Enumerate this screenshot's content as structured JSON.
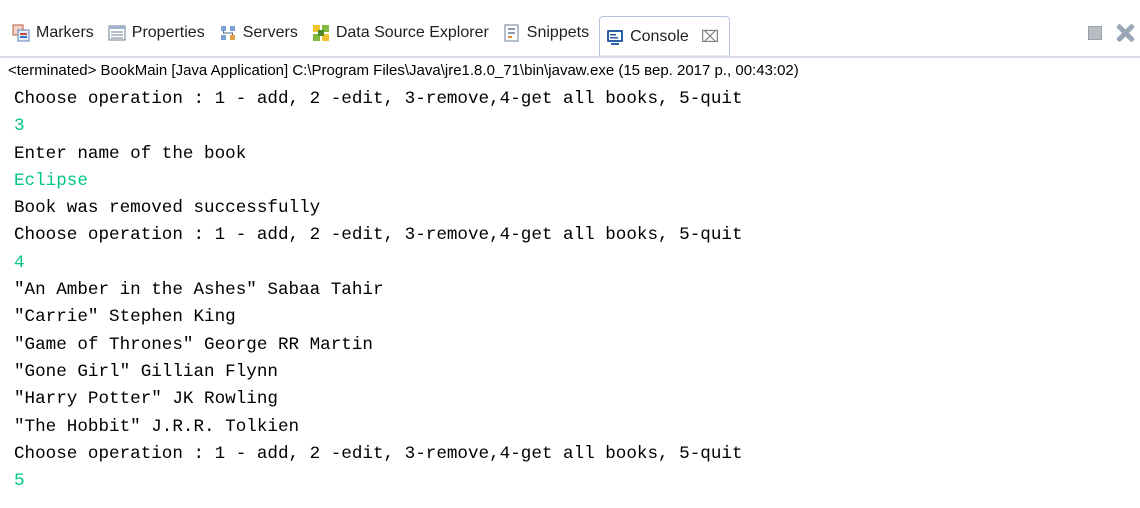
{
  "tabs": [
    {
      "label": "Markers",
      "icon": "markers-icon",
      "active": false
    },
    {
      "label": "Properties",
      "icon": "properties-icon",
      "active": false
    },
    {
      "label": "Servers",
      "icon": "servers-icon",
      "active": false
    },
    {
      "label": "Data Source Explorer",
      "icon": "data-source-icon",
      "active": false
    },
    {
      "label": "Snippets",
      "icon": "snippets-icon",
      "active": false
    },
    {
      "label": "Console",
      "icon": "console-icon",
      "active": true,
      "close": "⌧"
    }
  ],
  "status": "<terminated> BookMain [Java Application] C:\\Program Files\\Java\\jre1.8.0_71\\bin\\javaw.exe (15 вер. 2017 р., 00:43:02)",
  "colors": {
    "output": "#000000",
    "input": "#00c87f"
  },
  "console": [
    {
      "text": "Choose operation : 1 - add, 2 -edit, 3-remove,4-get all books, 5-quit",
      "kind": "out"
    },
    {
      "text": "3",
      "kind": "in"
    },
    {
      "text": "Enter name of the book",
      "kind": "out"
    },
    {
      "text": "Eclipse",
      "kind": "in"
    },
    {
      "text": "Book was removed successfully",
      "kind": "out"
    },
    {
      "text": "Choose operation : 1 - add, 2 -edit, 3-remove,4-get all books, 5-quit",
      "kind": "out"
    },
    {
      "text": "4",
      "kind": "in"
    },
    {
      "text": "\"An Amber in the Ashes\" Sabaa Tahir",
      "kind": "out"
    },
    {
      "text": "\"Carrie\" Stephen King",
      "kind": "out"
    },
    {
      "text": "\"Game of Thrones\" George RR Martin",
      "kind": "out"
    },
    {
      "text": "\"Gone Girl\" Gillian Flynn",
      "kind": "out"
    },
    {
      "text": "\"Harry Potter\" JK Rowling",
      "kind": "out"
    },
    {
      "text": "\"The Hobbit\" J.R.R. Tolkien",
      "kind": "out"
    },
    {
      "text": "Choose operation : 1 - add, 2 -edit, 3-remove,4-get all books, 5-quit",
      "kind": "out"
    },
    {
      "text": "5",
      "kind": "in"
    }
  ]
}
